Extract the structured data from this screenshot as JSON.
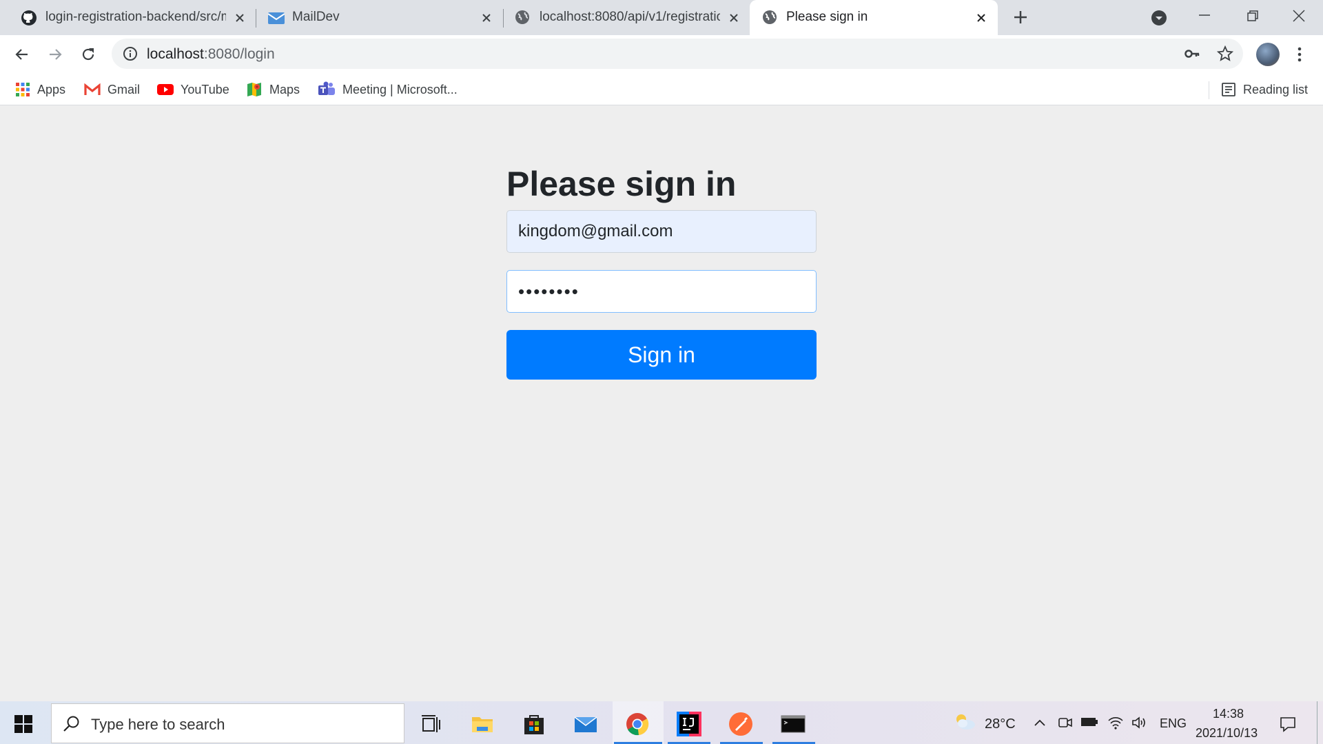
{
  "browser": {
    "tabs": [
      {
        "title": "login-registration-backend/src/m",
        "icon": "github-icon"
      },
      {
        "title": "MailDev",
        "icon": "mail-icon"
      },
      {
        "title": "localhost:8080/api/v1/registratio",
        "icon": "globe-icon"
      },
      {
        "title": "Please sign in",
        "icon": "globe-icon",
        "active": true
      }
    ],
    "url_host": "localhost",
    "url_path": ":8080/login",
    "bookmarks": [
      {
        "label": "Apps",
        "icon": "apps-icon"
      },
      {
        "label": "Gmail",
        "icon": "gmail-icon"
      },
      {
        "label": "YouTube",
        "icon": "youtube-icon"
      },
      {
        "label": "Maps",
        "icon": "maps-icon"
      },
      {
        "label": "Meeting | Microsoft...",
        "icon": "teams-icon"
      }
    ],
    "reading_list": "Reading list"
  },
  "login": {
    "heading": "Please sign in",
    "email_value": "kingdom@gmail.com",
    "password_value": "••••••••",
    "button_label": "Sign in"
  },
  "taskbar": {
    "search_placeholder": "Type here to search",
    "weather_temp": "28°C",
    "language": "ENG",
    "time": "14:38",
    "date": "2021/10/13"
  },
  "colors": {
    "primary_button": "#007bff",
    "autofill_bg": "#e8f0fe",
    "page_bg": "#eeeeee"
  }
}
